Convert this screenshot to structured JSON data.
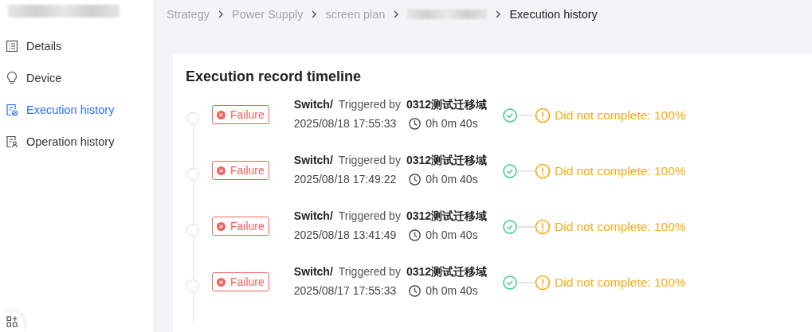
{
  "sidebar": {
    "items": [
      {
        "label": "Details",
        "kind": "list",
        "selected": false
      },
      {
        "label": "Device",
        "kind": "bulb",
        "selected": false
      },
      {
        "label": "Execution history",
        "kind": "record",
        "selected": true
      },
      {
        "label": "Operation history",
        "kind": "log",
        "selected": false
      }
    ]
  },
  "breadcrumb": [
    {
      "label": "Strategy",
      "kind": "link"
    },
    {
      "label": "Power Supply",
      "kind": "link"
    },
    {
      "label": "screen plan",
      "kind": "link"
    },
    {
      "kind": "redacted"
    },
    {
      "label": "Execution history",
      "kind": "current"
    }
  ],
  "timeline": {
    "title": "Execution record timeline",
    "records": [
      {
        "status": "Failure",
        "action": "Switch/",
        "triggered_label": "Triggered by",
        "trigger": "0312测试迁移域",
        "time": "2025/08/18 17:55:33",
        "duration": "0h 0m 40s",
        "result": "Did not complete: 100%"
      },
      {
        "status": "Failure",
        "action": "Switch/",
        "triggered_label": "Triggered by",
        "trigger": "0312测试迁移域",
        "time": "2025/08/18 17:49:22",
        "duration": "0h 0m 40s",
        "result": "Did not complete: 100%"
      },
      {
        "status": "Failure",
        "action": "Switch/",
        "triggered_label": "Triggered by",
        "trigger": "0312测试迁移域",
        "time": "2025/08/18 13:41:49",
        "duration": "0h 0m 40s",
        "result": "Did not complete: 100%"
      },
      {
        "status": "Failure",
        "action": "Switch/",
        "triggered_label": "Triggered by",
        "trigger": "0312测试迁移域",
        "time": "2025/08/17 17:55:33",
        "duration": "0h 0m 40s",
        "result": "Did not complete: 100%"
      }
    ]
  }
}
